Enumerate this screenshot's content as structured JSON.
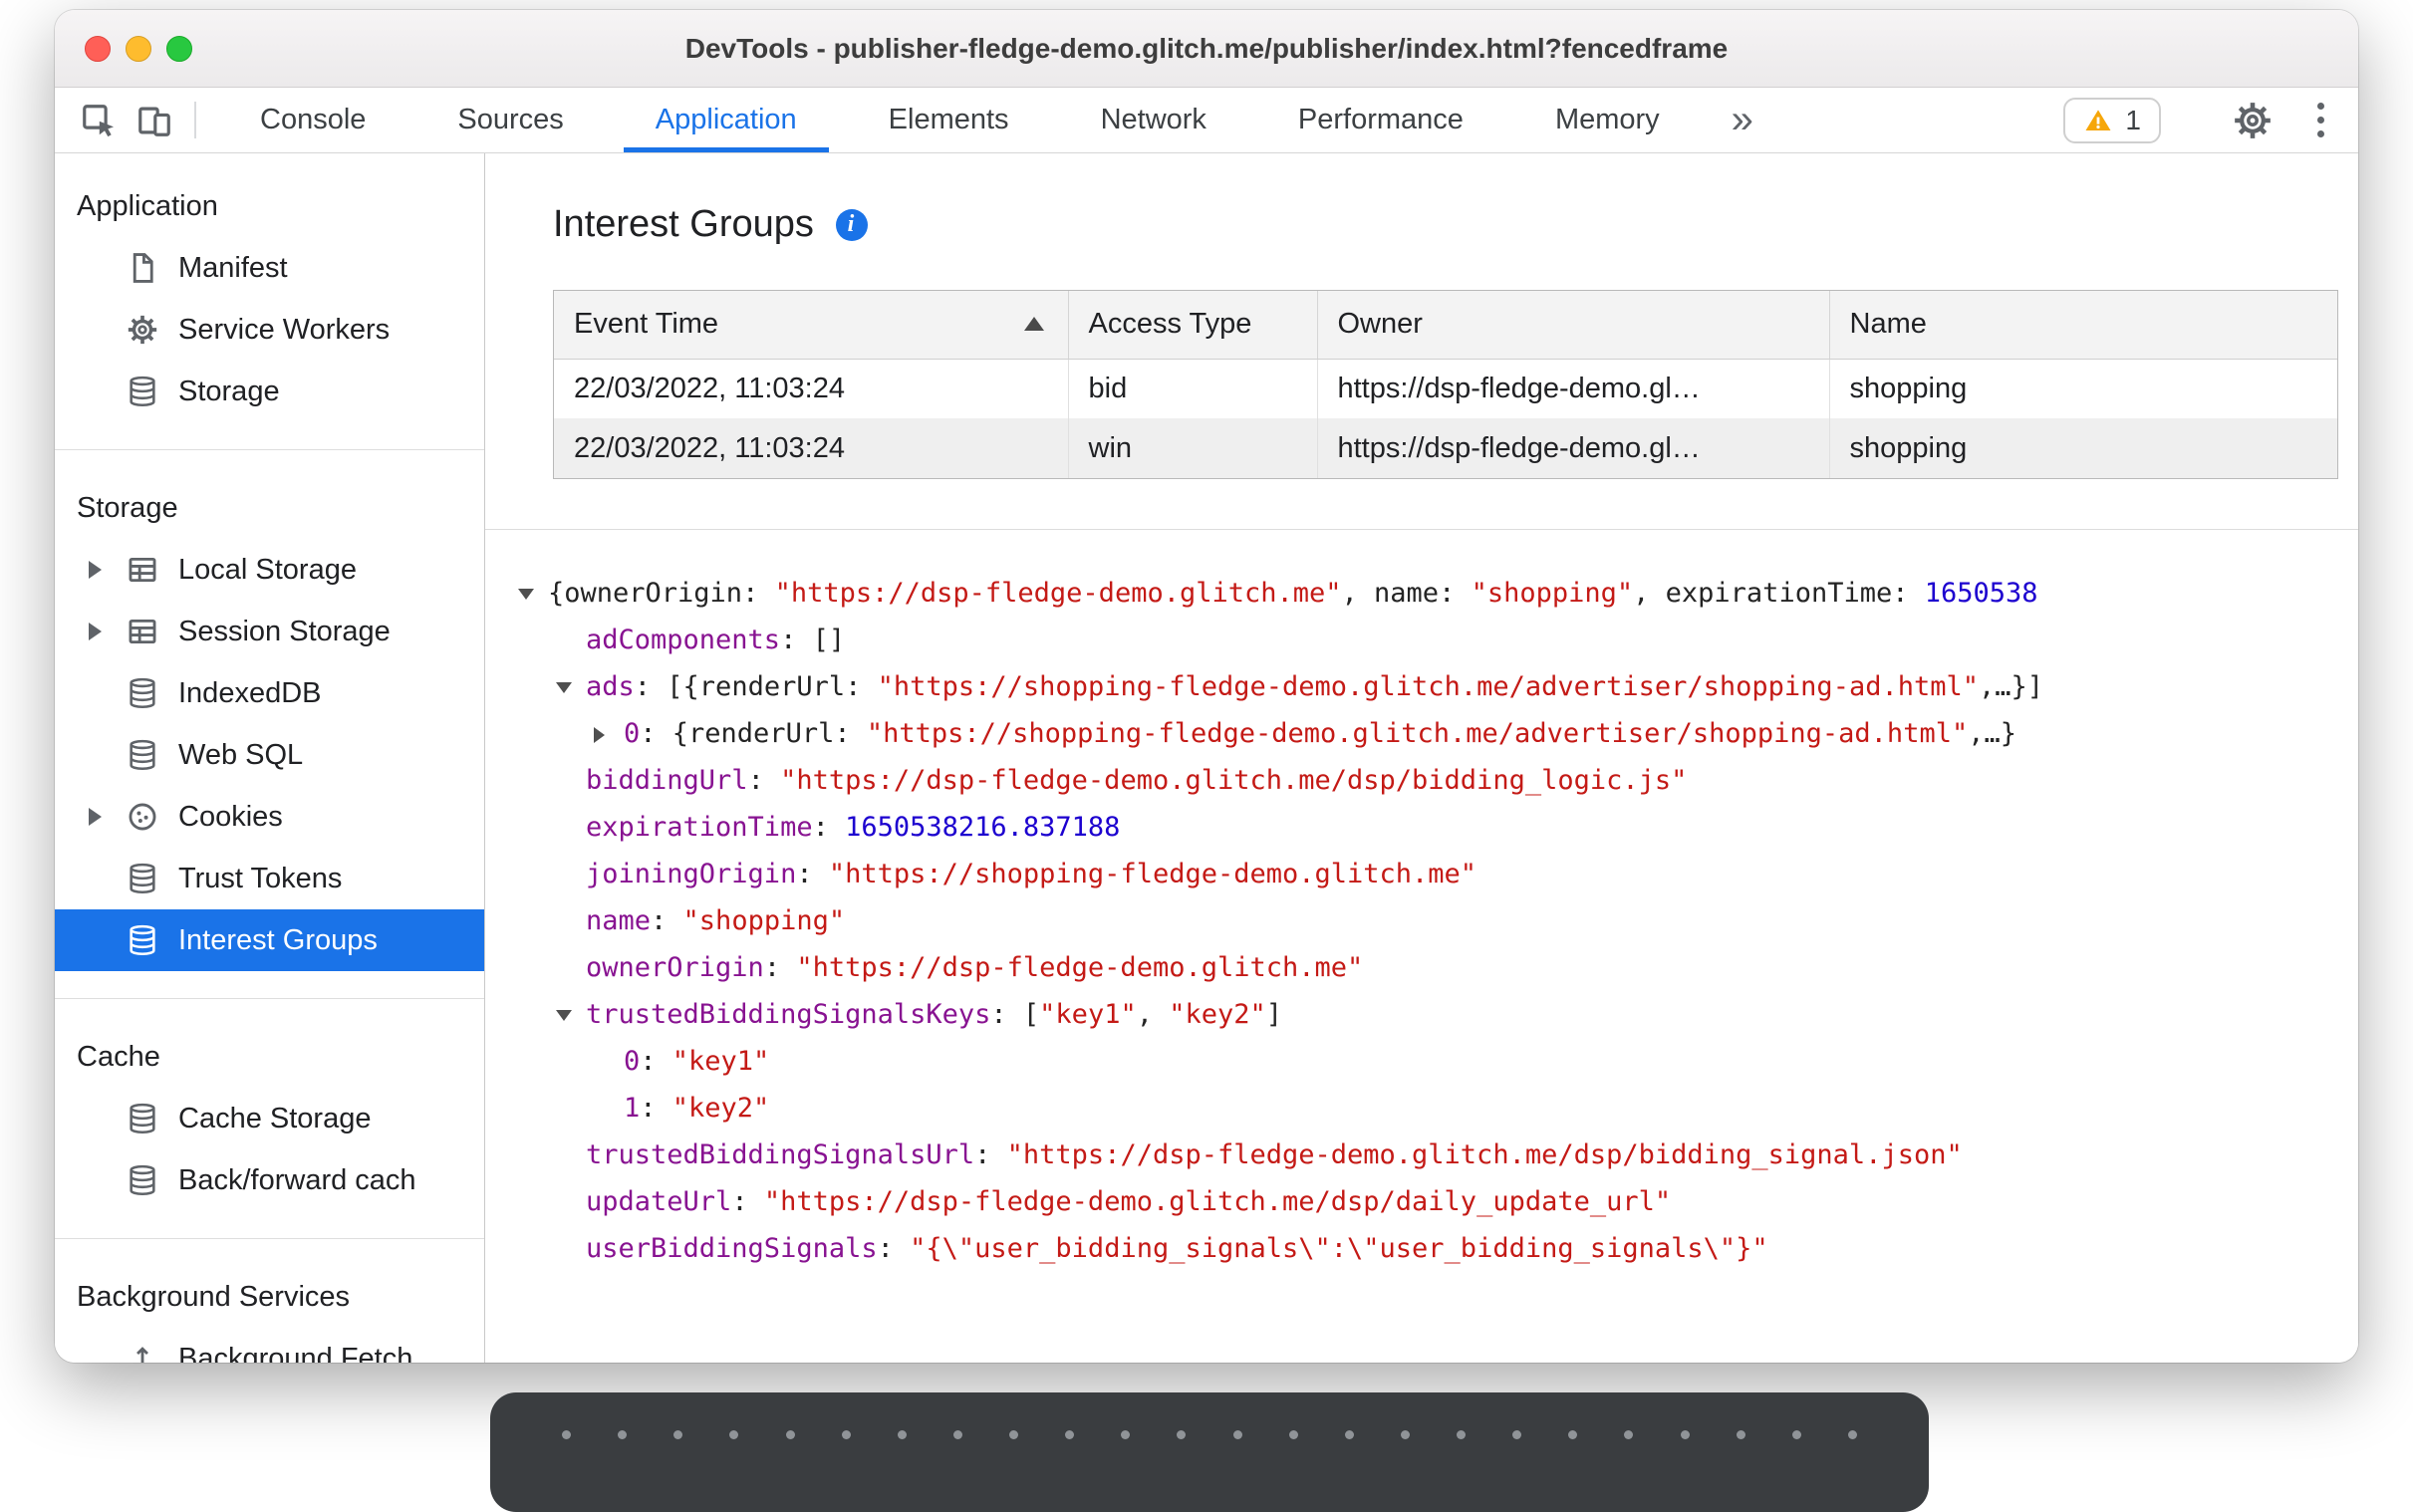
{
  "window": {
    "title": "DevTools - publisher-fledge-demo.glitch.me/publisher/index.html?fencedframe"
  },
  "toolbar": {
    "inspect_icon": "inspect-cursor-icon",
    "device_icon": "device-toolbar-icon",
    "tabs": [
      {
        "label": "Console",
        "active": false
      },
      {
        "label": "Sources",
        "active": false
      },
      {
        "label": "Application",
        "active": true
      },
      {
        "label": "Elements",
        "active": false
      },
      {
        "label": "Network",
        "active": false
      },
      {
        "label": "Performance",
        "active": false
      },
      {
        "label": "Memory",
        "active": false
      }
    ],
    "more_tabs_label": "»",
    "warning_icon": "warning-triangle-icon",
    "warning_count": "1",
    "settings_icon": "gear-icon",
    "menu_icon": "kebab-menu-icon"
  },
  "sidebar": {
    "sections": [
      {
        "title": "Application",
        "items": [
          {
            "label": "Manifest",
            "icon": "document-icon",
            "expandable": false,
            "selected": false
          },
          {
            "label": "Service Workers",
            "icon": "gear-icon",
            "expandable": false,
            "selected": false
          },
          {
            "label": "Storage",
            "icon": "database-icon",
            "expandable": false,
            "selected": false
          }
        ]
      },
      {
        "title": "Storage",
        "items": [
          {
            "label": "Local Storage",
            "icon": "table-icon",
            "expandable": true,
            "selected": false
          },
          {
            "label": "Session Storage",
            "icon": "table-icon",
            "expandable": true,
            "selected": false
          },
          {
            "label": "IndexedDB",
            "icon": "database-icon",
            "expandable": false,
            "selected": false
          },
          {
            "label": "Web SQL",
            "icon": "database-icon",
            "expandable": false,
            "selected": false
          },
          {
            "label": "Cookies",
            "icon": "cookie-icon",
            "expandable": true,
            "selected": false
          },
          {
            "label": "Trust Tokens",
            "icon": "database-icon",
            "expandable": false,
            "selected": false
          },
          {
            "label": "Interest Groups",
            "icon": "database-icon",
            "expandable": false,
            "selected": true
          }
        ]
      },
      {
        "title": "Cache",
        "items": [
          {
            "label": "Cache Storage",
            "icon": "database-icon",
            "expandable": false,
            "selected": false
          },
          {
            "label": "Back/forward cach",
            "icon": "database-icon",
            "expandable": false,
            "selected": false
          }
        ]
      },
      {
        "title": "Background Services",
        "items": [
          {
            "label": "Background Fetch",
            "icon": "background-fetch-icon",
            "expandable": false,
            "selected": false
          }
        ]
      }
    ]
  },
  "main": {
    "heading": "Interest Groups",
    "info_icon": "info-icon",
    "table": {
      "columns": [
        "Event Time",
        "Access Type",
        "Owner",
        "Name"
      ],
      "sort_column": "Event Time",
      "sort_direction": "ascending",
      "rows": [
        [
          "22/03/2022, 11:03:24",
          "bid",
          "https://dsp-fledge-demo.gl…",
          "shopping"
        ],
        [
          "22/03/2022, 11:03:24",
          "win",
          "https://dsp-fledge-demo.gl…",
          "shopping"
        ]
      ]
    },
    "tree": {
      "lines": [
        {
          "indent": 0,
          "arrow": "down",
          "segments": [
            [
              "plain",
              "{ownerOrigin: "
            ],
            [
              "str",
              "\"https://dsp-fledge-demo.glitch.me\""
            ],
            [
              "plain",
              ", name: "
            ],
            [
              "str",
              "\"shopping\""
            ],
            [
              "plain",
              ", expirationTime: "
            ],
            [
              "num",
              "1650538"
            ]
          ]
        },
        {
          "indent": 1,
          "arrow": null,
          "segments": [
            [
              "key",
              "adComponents"
            ],
            [
              "plain",
              ": []"
            ]
          ]
        },
        {
          "indent": 1,
          "arrow": "down",
          "segments": [
            [
              "key",
              "ads"
            ],
            [
              "plain",
              ": [{renderUrl: "
            ],
            [
              "str",
              "\"https://shopping-fledge-demo.glitch.me/advertiser/shopping-ad.html\""
            ],
            [
              "plain",
              ",…}]"
            ]
          ]
        },
        {
          "indent": 2,
          "arrow": "right",
          "segments": [
            [
              "key",
              "0"
            ],
            [
              "plain",
              ": {renderUrl: "
            ],
            [
              "str",
              "\"https://shopping-fledge-demo.glitch.me/advertiser/shopping-ad.html\""
            ],
            [
              "plain",
              ",…}"
            ]
          ]
        },
        {
          "indent": 1,
          "arrow": null,
          "segments": [
            [
              "key",
              "biddingUrl"
            ],
            [
              "plain",
              ": "
            ],
            [
              "str",
              "\"https://dsp-fledge-demo.glitch.me/dsp/bidding_logic.js\""
            ]
          ]
        },
        {
          "indent": 1,
          "arrow": null,
          "segments": [
            [
              "key",
              "expirationTime"
            ],
            [
              "plain",
              ": "
            ],
            [
              "num",
              "1650538216.837188"
            ]
          ]
        },
        {
          "indent": 1,
          "arrow": null,
          "segments": [
            [
              "key",
              "joiningOrigin"
            ],
            [
              "plain",
              ": "
            ],
            [
              "str",
              "\"https://shopping-fledge-demo.glitch.me\""
            ]
          ]
        },
        {
          "indent": 1,
          "arrow": null,
          "segments": [
            [
              "key",
              "name"
            ],
            [
              "plain",
              ": "
            ],
            [
              "str",
              "\"shopping\""
            ]
          ]
        },
        {
          "indent": 1,
          "arrow": null,
          "segments": [
            [
              "key",
              "ownerOrigin"
            ],
            [
              "plain",
              ": "
            ],
            [
              "str",
              "\"https://dsp-fledge-demo.glitch.me\""
            ]
          ]
        },
        {
          "indent": 1,
          "arrow": "down",
          "segments": [
            [
              "key",
              "trustedBiddingSignalsKeys"
            ],
            [
              "plain",
              ": ["
            ],
            [
              "str",
              "\"key1\""
            ],
            [
              "plain",
              ", "
            ],
            [
              "str",
              "\"key2\""
            ],
            [
              "plain",
              "]"
            ]
          ]
        },
        {
          "indent": 2,
          "arrow": null,
          "segments": [
            [
              "key",
              "0"
            ],
            [
              "plain",
              ": "
            ],
            [
              "str",
              "\"key1\""
            ]
          ]
        },
        {
          "indent": 2,
          "arrow": null,
          "segments": [
            [
              "key",
              "1"
            ],
            [
              "plain",
              ": "
            ],
            [
              "str",
              "\"key2\""
            ]
          ]
        },
        {
          "indent": 1,
          "arrow": null,
          "segments": [
            [
              "key",
              "trustedBiddingSignalsUrl"
            ],
            [
              "plain",
              ": "
            ],
            [
              "str",
              "\"https://dsp-fledge-demo.glitch.me/dsp/bidding_signal.json\""
            ]
          ]
        },
        {
          "indent": 1,
          "arrow": null,
          "segments": [
            [
              "key",
              "updateUrl"
            ],
            [
              "plain",
              ": "
            ],
            [
              "str",
              "\"https://dsp-fledge-demo.glitch.me/dsp/daily_update_url\""
            ]
          ]
        },
        {
          "indent": 1,
          "arrow": null,
          "segments": [
            [
              "key",
              "userBiddingSignals"
            ],
            [
              "plain",
              ": "
            ],
            [
              "str",
              "\"{\\\"user_bidding_signals\\\":\\\"user_bidding_signals\\\"}\""
            ]
          ]
        }
      ]
    }
  },
  "colors": {
    "accent_blue": "#1a73e8",
    "key_purple": "#881391",
    "string_red": "#c41a16",
    "number_blue": "#1c00cf",
    "warning_yellow": "#f6a609",
    "selected_row_blue": "#1a73e8"
  }
}
